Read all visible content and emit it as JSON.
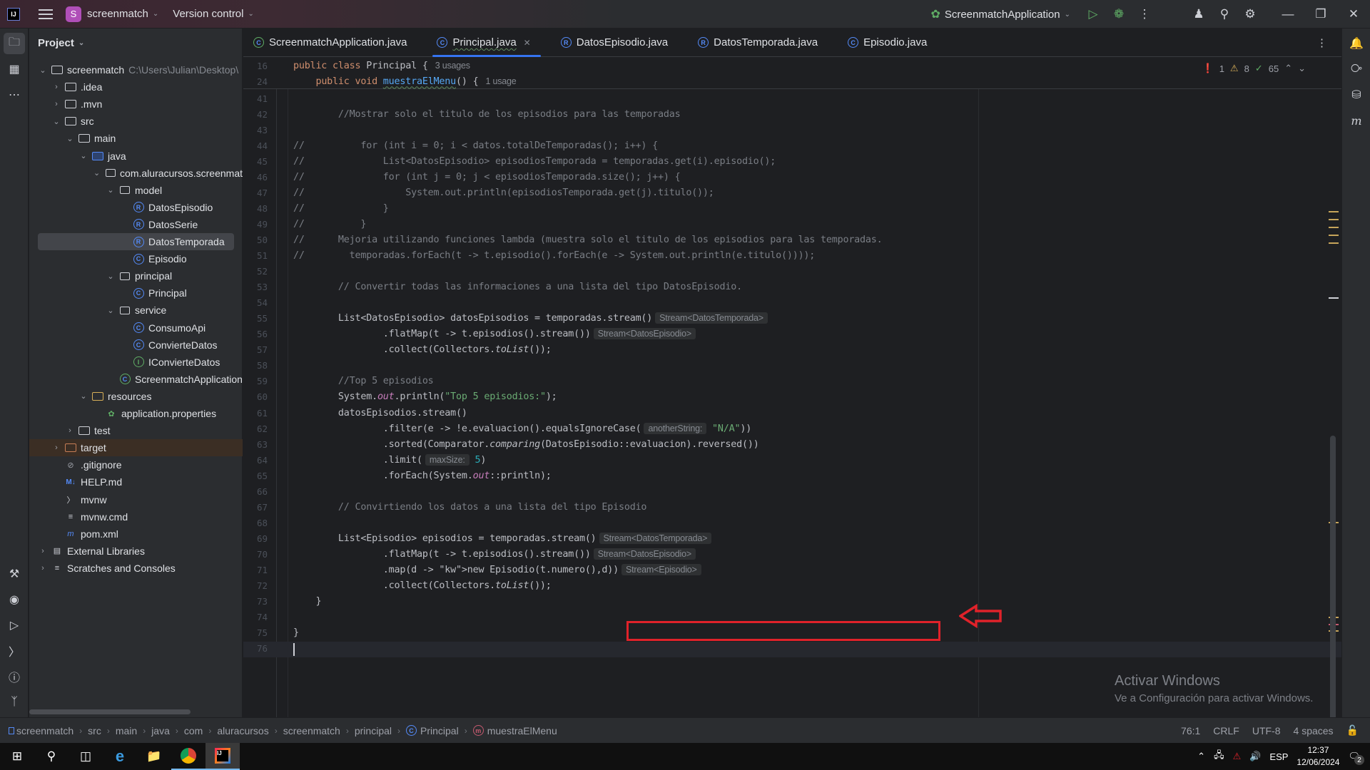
{
  "titlebar": {
    "project_badge": "S",
    "project_name": "screenmatch",
    "version_control": "Version control",
    "run_config": "ScreenmatchApplication"
  },
  "project_panel": {
    "title": "Project",
    "tree": [
      {
        "label": "screenmatch",
        "extra": "C:\\Users\\Julian\\Desktop\\",
        "depth": 0,
        "twisty": "open",
        "icon": "module-folder-icon"
      },
      {
        "label": ".idea",
        "depth": 1,
        "twisty": "closed",
        "icon": "folder-icon"
      },
      {
        "label": ".mvn",
        "depth": 1,
        "twisty": "closed",
        "icon": "folder-icon"
      },
      {
        "label": "src",
        "depth": 1,
        "twisty": "open",
        "icon": "folder-icon"
      },
      {
        "label": "main",
        "depth": 2,
        "twisty": "open",
        "icon": "folder-icon"
      },
      {
        "label": "java",
        "depth": 3,
        "twisty": "open",
        "icon": "source-folder-icon"
      },
      {
        "label": "com.aluracursos.screenmat",
        "depth": 4,
        "twisty": "open",
        "icon": "package-icon"
      },
      {
        "label": "model",
        "depth": 5,
        "twisty": "open",
        "icon": "package-icon"
      },
      {
        "label": "DatosEpisodio",
        "depth": 6,
        "icon": "record-icon"
      },
      {
        "label": "DatosSerie",
        "depth": 6,
        "icon": "record-icon"
      },
      {
        "label": "DatosTemporada",
        "depth": 6,
        "icon": "record-icon",
        "selected": true
      },
      {
        "label": "Episodio",
        "depth": 6,
        "icon": "class-icon"
      },
      {
        "label": "principal",
        "depth": 5,
        "twisty": "open",
        "icon": "package-icon"
      },
      {
        "label": "Principal",
        "depth": 6,
        "icon": "class-icon"
      },
      {
        "label": "service",
        "depth": 5,
        "twisty": "open",
        "icon": "package-icon"
      },
      {
        "label": "ConsumoApi",
        "depth": 6,
        "icon": "class-icon"
      },
      {
        "label": "ConvierteDatos",
        "depth": 6,
        "icon": "class-icon"
      },
      {
        "label": "IConvierteDatos",
        "depth": 6,
        "icon": "interface-icon"
      },
      {
        "label": "ScreenmatchApplication",
        "depth": 5,
        "icon": "spring-boot-class-icon"
      },
      {
        "label": "resources",
        "depth": 3,
        "twisty": "open",
        "icon": "resources-folder-icon"
      },
      {
        "label": "application.properties",
        "depth": 4,
        "icon": "spring-properties-icon"
      },
      {
        "label": "test",
        "depth": 2,
        "twisty": "closed",
        "icon": "folder-icon"
      },
      {
        "label": "target",
        "depth": 1,
        "twisty": "closed",
        "icon": "excluded-folder-icon",
        "excluded": true
      },
      {
        "label": ".gitignore",
        "depth": 1,
        "icon": "gitignore-icon"
      },
      {
        "label": "HELP.md",
        "depth": 1,
        "icon": "markdown-icon"
      },
      {
        "label": "mvnw",
        "depth": 1,
        "icon": "shell-script-icon"
      },
      {
        "label": "mvnw.cmd",
        "depth": 1,
        "icon": "text-file-icon"
      },
      {
        "label": "pom.xml",
        "depth": 1,
        "icon": "maven-icon"
      },
      {
        "label": "External Libraries",
        "depth": 0,
        "twisty": "closed",
        "icon": "library-icon"
      },
      {
        "label": "Scratches and Consoles",
        "depth": 0,
        "twisty": "closed",
        "icon": "scratches-icon"
      }
    ]
  },
  "tabs": [
    {
      "label": "ScreenmatchApplication.java",
      "icon": "spring-boot-class-icon"
    },
    {
      "label": "Principal.java",
      "icon": "class-icon",
      "active": true
    },
    {
      "label": "DatosEpisodio.java",
      "icon": "record-icon"
    },
    {
      "label": "DatosTemporada.java",
      "icon": "record-icon"
    },
    {
      "label": "Episodio.java",
      "icon": "class-icon"
    }
  ],
  "inspections": {
    "errors": "1",
    "warnings": "8",
    "ok": "65"
  },
  "sticky": [
    {
      "num": "16",
      "code": "public class Principal {",
      "hint": "3 usages"
    },
    {
      "num": "24",
      "code": "public void muestraElMenu() {",
      "hint": "1 usage"
    }
  ],
  "code_lines": [
    {
      "num": "41",
      "text": ""
    },
    {
      "num": "42",
      "text": "        //Mostrar solo el titulo de los episodios para las temporadas"
    },
    {
      "num": "43",
      "text": ""
    },
    {
      "num": "44",
      "text": "//          for (int i = 0; i < datos.totalDeTemporadas(); i++) {"
    },
    {
      "num": "45",
      "text": "//              List<DatosEpisodio> episodiosTemporada = temporadas.get(i).episodio();"
    },
    {
      "num": "46",
      "text": "//              for (int j = 0; j < episodiosTemporada.size(); j++) {"
    },
    {
      "num": "47",
      "text": "//                  System.out.println(episodiosTemporada.get(j).titulo());"
    },
    {
      "num": "48",
      "text": "//              }"
    },
    {
      "num": "49",
      "text": "//          }"
    },
    {
      "num": "50",
      "text": "//      Mejoria utilizando funciones lambda (muestra solo el titulo de los episodios para las temporadas."
    },
    {
      "num": "51",
      "text": "//        temporadas.forEach(t -> t.episodio().forEach(e -> System.out.println(e.titulo())));"
    },
    {
      "num": "52",
      "text": ""
    },
    {
      "num": "53",
      "text": "        // Convertir todas las informaciones a una lista del tipo DatosEpisodio."
    },
    {
      "num": "54",
      "text": ""
    },
    {
      "num": "55",
      "text": "        List<DatosEpisodio> datosEpisodios = temporadas.stream()",
      "hint": "Stream<DatosTemporada>"
    },
    {
      "num": "56",
      "text": "                .flatMap(t -> t.episodios().stream())",
      "hint": "Stream<DatosEpisodio>"
    },
    {
      "num": "57",
      "text": "                .collect(Collectors.toList());"
    },
    {
      "num": "58",
      "text": ""
    },
    {
      "num": "59",
      "text": "        //Top 5 episodios"
    },
    {
      "num": "60",
      "text": "        System.out.println(\"Top 5 episodios:\");"
    },
    {
      "num": "61",
      "text": "        datosEpisodios.stream()"
    },
    {
      "num": "62",
      "text": "                .filter(e -> !e.evaluacion().equalsIgnoreCase(",
      "param_hint": "anotherString:",
      "tail": "\"N/A\"))"
    },
    {
      "num": "63",
      "text": "                .sorted(Comparator.comparing(DatosEpisodio::evaluacion).reversed())"
    },
    {
      "num": "64",
      "text": "                .limit(",
      "param_hint": "maxSize:",
      "tail": "5)"
    },
    {
      "num": "65",
      "text": "                .forEach(System.out::println);"
    },
    {
      "num": "66",
      "text": ""
    },
    {
      "num": "67",
      "text": "        // Convirtiendo los datos a una lista del tipo Episodio"
    },
    {
      "num": "68",
      "text": ""
    },
    {
      "num": "69",
      "text": "        List<Episodio> episodios = temporadas.stream()",
      "hint": "Stream<DatosTemporada>"
    },
    {
      "num": "70",
      "text": "                .flatMap(t -> t.episodios().stream())",
      "hint": "Stream<DatosEpisodio>"
    },
    {
      "num": "71",
      "text": "                .map(d -> new Episodio(t.numero(),d))",
      "hint": "Stream<Episodio>"
    },
    {
      "num": "72",
      "text": "                .collect(Collectors.toList());"
    },
    {
      "num": "73",
      "text": "    }"
    },
    {
      "num": "74",
      "text": ""
    },
    {
      "num": "75",
      "text": "}"
    },
    {
      "num": "76",
      "text": ""
    }
  ],
  "watermark": {
    "title": "Activar Windows",
    "subtitle": "Ve a Configuración para activar Windows."
  },
  "statusbar": {
    "breadcrumbs": [
      "screenmatch",
      "src",
      "main",
      "java",
      "com",
      "aluracursos",
      "screenmatch",
      "principal",
      "Principal",
      "muestraElMenu"
    ],
    "position": "76:1",
    "line_sep": "CRLF",
    "encoding": "UTF-8",
    "indent": "4 spaces"
  },
  "taskbar": {
    "language": "ESP",
    "time": "12:37",
    "date": "12/06/2024",
    "notifications": "2"
  },
  "annotation_colors": {
    "box": "#e0222a",
    "arrow": "#e0222a"
  }
}
